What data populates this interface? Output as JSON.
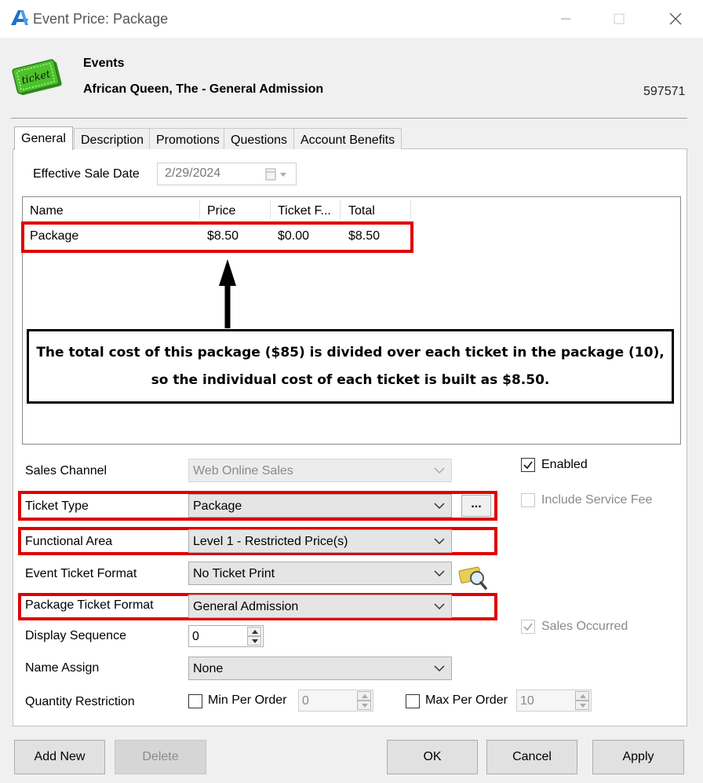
{
  "window": {
    "title": "Event Price: Package"
  },
  "header": {
    "category": "Events",
    "event_name": "African Queen, The - General Admission",
    "record_id": "597571",
    "ticket_icon_text": "ticket"
  },
  "tabs": [
    {
      "label": "General",
      "active": true
    },
    {
      "label": "Description",
      "active": false
    },
    {
      "label": "Promotions",
      "active": false
    },
    {
      "label": "Questions",
      "active": false
    },
    {
      "label": "Account Benefits",
      "active": false
    }
  ],
  "effective_sale_date": {
    "label": "Effective Sale Date",
    "value": "2/29/2024"
  },
  "grid": {
    "columns": [
      "Name",
      "Price",
      "Ticket F...",
      "Total"
    ],
    "rows": [
      {
        "name": "Package",
        "price": "$8.50",
        "ticket_fee": "$0.00",
        "total": "$8.50"
      }
    ]
  },
  "annotation": {
    "line1": "The total cost of this package ($85) is divided over each ticket in the package (10),",
    "line2": "so the individual cost of each ticket is built as $8.50."
  },
  "form": {
    "sales_channel": {
      "label": "Sales Channel",
      "value": "Web Online Sales"
    },
    "ticket_type": {
      "label": "Ticket Type",
      "value": "Package",
      "ellipsis": "..."
    },
    "functional_area": {
      "label": "Functional Area",
      "value": "Level 1 - Restricted Price(s)"
    },
    "event_ticket_format": {
      "label": "Event Ticket Format",
      "value": "No Ticket Print"
    },
    "package_ticket_format": {
      "label": "Package Ticket Format",
      "value": "General Admission"
    },
    "display_sequence": {
      "label": "Display Sequence",
      "value": "0"
    },
    "name_assign": {
      "label": "Name Assign",
      "value": "None"
    },
    "quantity_restriction": {
      "label": "Quantity Restriction",
      "min_label": "Min Per Order",
      "min_value": "0",
      "max_label": "Max Per Order",
      "max_value": "10"
    },
    "enabled": {
      "label": "Enabled",
      "checked": true
    },
    "include_service_fee": {
      "label": "Include Service Fee",
      "checked": false
    },
    "sales_occurred": {
      "label": "Sales Occurred",
      "checked": true
    }
  },
  "buttons": {
    "add_new": "Add New",
    "delete": "Delete",
    "ok": "OK",
    "cancel": "Cancel",
    "apply": "Apply"
  },
  "colors": {
    "highlight": "#e00000",
    "logo_blue": "#1e6fd0",
    "ticket_green": "#4cc22a"
  }
}
